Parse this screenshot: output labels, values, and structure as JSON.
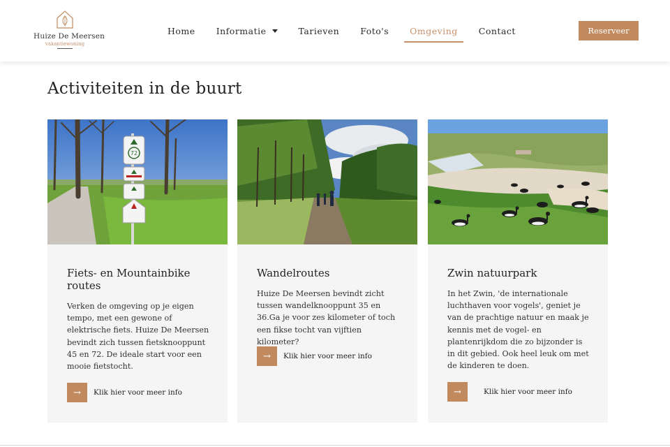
{
  "brand": {
    "name": "Huize De Meersen",
    "tagline": "vakantiewoning"
  },
  "nav": {
    "items": [
      {
        "label": "Home"
      },
      {
        "label": "Informatie"
      },
      {
        "label": "Tarieven"
      },
      {
        "label": "Foto's"
      },
      {
        "label": "Omgeving"
      },
      {
        "label": "Contact"
      }
    ],
    "active": "Omgeving",
    "reserve_label": "Reserveer"
  },
  "main": {
    "title": "Activiteiten in de buurt",
    "cards": [
      {
        "title": "Fiets- en Mountainbike routes",
        "text": "Verken de omgeving op je eigen tempo, met een gewone of elektrische fiets. Huize De Meersen bevindt zich tussen fietsknooppunt 45 en 72. De ideale start voor een mooie fietstocht.",
        "link_label": "Klik hier voor meer info",
        "sign_number": "72"
      },
      {
        "title": "Wandelroutes",
        "text": "Huize De Meersen bevindt zicht tussen wandelknooppunt 35 en 36.Ga je voor zes kilometer of toch een fikse tocht van vijftien kilometer?",
        "link_label": "Klik hier voor meer info"
      },
      {
        "title": "Zwin natuurpark",
        "text": "In het Zwin, 'de internationale luchthaven voor vogels', geniet je van de prachtige natuur en maak je kennis met de vogel- en plantenrijkdom die zo bijzonder is in dit gebied. Ook heel leuk om met de kinderen te doen.",
        "link_label": "Klik hier voor meer info"
      }
    ]
  },
  "colors": {
    "accent": "#c08a5e",
    "card_bg": "#f5f5f5"
  },
  "icons": {
    "logo": "house-leaf-icon",
    "dropdown": "chevron-down-icon",
    "more": "arrow-right-icon"
  }
}
